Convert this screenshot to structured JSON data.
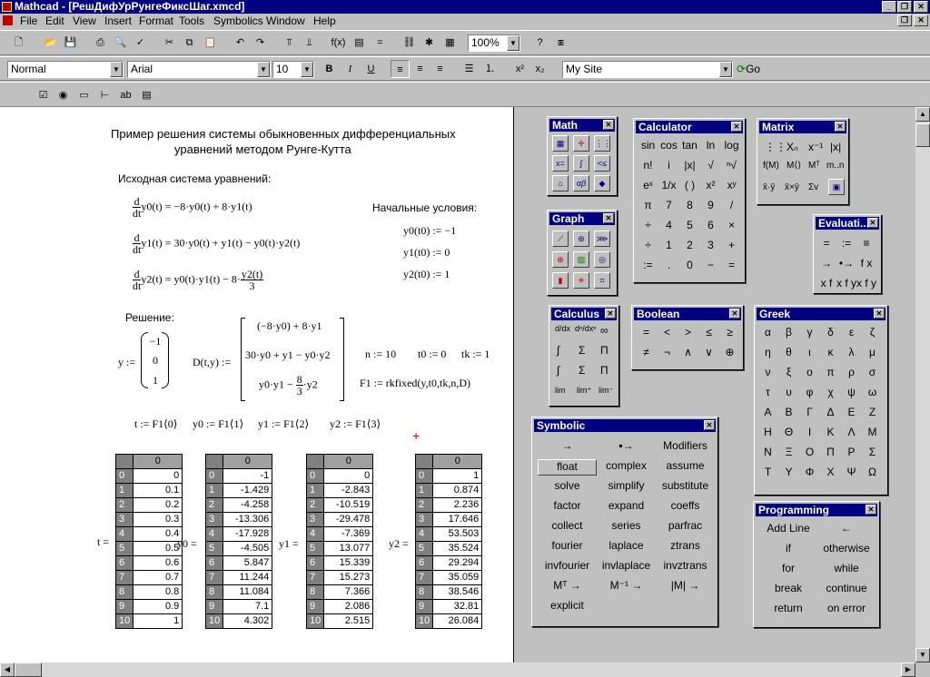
{
  "window": {
    "title": "Mathcad - [РешДифУрРунгеФиксШаг.xmcd]"
  },
  "menu": [
    "File",
    "Edit",
    "View",
    "Insert",
    "Format",
    "Tools",
    "Symbolics",
    "Window",
    "Help"
  ],
  "toolbar": {
    "zoom": "100%"
  },
  "format_bar": {
    "style": "Normal",
    "font": "Arial",
    "size": "10",
    "bold": "B",
    "italic": "I",
    "underline": "U",
    "address": "My Site",
    "go": "Go"
  },
  "doc": {
    "title_line1": "Пример решения системы обыкновенных дифференциальных",
    "title_line2": "уравнений методом Рунге-Кутта",
    "source_label": "Исходная система уравнений:",
    "initial_label": "Начальные условия:",
    "solution_label": "Решение:",
    "d": "d",
    "dt": "dt",
    "eq1_lhs": "y0(t)",
    "eq1_rhs": "= −8·y0(t) + 8·y1(t)",
    "eq2_lhs": "y1(t)",
    "eq2_rhs": "= 30·y0(t) + y1(t) − y0(t)·y2(t)",
    "eq3_lhs": "y2(t)",
    "eq3_mid": "= y0(t)·y1(t) − 8·",
    "eq3_num": "y2(t)",
    "eq3_den": "3",
    "ic1": "y0(t0) := −1",
    "ic2": "y1(t0) := 0",
    "ic3": "y2(t0) := 1",
    "y_def": "y :=",
    "y_vec": [
      "−1",
      "0",
      "1"
    ],
    "D_def": "D(t,y) :=",
    "D_row1": "(−8·y0) + 8·y1",
    "D_row2": "30·y0 + y1 − y0·y2",
    "D_row3a": "y0·y1 −",
    "D_row3_num": "8",
    "D_row3_den": "3",
    "D_row3b": "·y2",
    "n_def": "n := 10",
    "t0_def": "t0 := 0",
    "tk_def": "tk := 1",
    "F1_def": "F1 := rkfixed(y,t0,tk,n,D)",
    "t_col": "t := F1⟨0⟩",
    "y0_col": "y0 := F1⟨1⟩",
    "y1_col": "y1 := F1⟨2⟩",
    "y2_col": "y2 := F1⟨3⟩",
    "cursor": "+"
  },
  "tables": [
    {
      "label": "t =",
      "header": "0",
      "idx": [
        "0",
        "1",
        "2",
        "3",
        "4",
        "5",
        "6",
        "7",
        "8",
        "9",
        "10"
      ],
      "vals": [
        "0",
        "0.1",
        "0.2",
        "0.3",
        "0.4",
        "0.5",
        "0.6",
        "0.7",
        "0.8",
        "0.9",
        "1"
      ]
    },
    {
      "label": "y0 =",
      "header": "0",
      "idx": [
        "0",
        "1",
        "2",
        "3",
        "4",
        "5",
        "6",
        "7",
        "8",
        "9",
        "10"
      ],
      "vals": [
        "-1",
        "-1.429",
        "-4.258",
        "-13.306",
        "-17.928",
        "-4.505",
        "5.847",
        "11.244",
        "11.084",
        "7.1",
        "4.302"
      ]
    },
    {
      "label": "y1 =",
      "header": "0",
      "idx": [
        "0",
        "1",
        "2",
        "3",
        "4",
        "5",
        "6",
        "7",
        "8",
        "9",
        "10"
      ],
      "vals": [
        "0",
        "-2.843",
        "-10.519",
        "-29.478",
        "-7.369",
        "13.077",
        "15.339",
        "15.273",
        "7.366",
        "2.086",
        "2.515"
      ]
    },
    {
      "label": "y2 =",
      "header": "0",
      "idx": [
        "0",
        "1",
        "2",
        "3",
        "4",
        "5",
        "6",
        "7",
        "8",
        "9",
        "10"
      ],
      "vals": [
        "1",
        "0.874",
        "2.236",
        "17.646",
        "53.503",
        "35.524",
        "29.294",
        "35.059",
        "38.546",
        "32.81",
        "26.084"
      ]
    }
  ],
  "palettes": {
    "math": {
      "title": "Math"
    },
    "graph": {
      "title": "Graph"
    },
    "calculus": {
      "title": "Calculus"
    },
    "calculator": {
      "title": "Calculator",
      "keys": [
        "sin",
        "cos",
        "tan",
        "ln",
        "log",
        "n!",
        "i",
        "|x|",
        "√",
        "ⁿ√",
        "eˣ",
        "1/x",
        "( )",
        "x²",
        "xʸ",
        "π",
        "7",
        "8",
        "9",
        "/",
        "÷",
        "4",
        "5",
        "6",
        "×",
        "÷",
        "1",
        "2",
        "3",
        "+",
        ":=",
        ".",
        "0",
        "−",
        "="
      ]
    },
    "matrix": {
      "title": "Matrix"
    },
    "evaluation": {
      "title": "Evaluati...",
      "keys": [
        "=",
        ":=",
        "≡",
        "→",
        "•→",
        "f x",
        "x f",
        "x f y",
        "x f y"
      ]
    },
    "boolean": {
      "title": "Boolean",
      "keys": [
        "=",
        "<",
        ">",
        "≤",
        "≥",
        "≠",
        "¬",
        "∧",
        "∨",
        "⊕"
      ]
    },
    "greek": {
      "title": "Greek",
      "keys": [
        "α",
        "β",
        "γ",
        "δ",
        "ε",
        "ζ",
        "η",
        "θ",
        "ι",
        "κ",
        "λ",
        "μ",
        "ν",
        "ξ",
        "ο",
        "π",
        "ρ",
        "σ",
        "τ",
        "υ",
        "φ",
        "χ",
        "ψ",
        "ω",
        "Α",
        "Β",
        "Γ",
        "Δ",
        "Ε",
        "Ζ",
        "Η",
        "Θ",
        "Ι",
        "Κ",
        "Λ",
        "Μ",
        "Ν",
        "Ξ",
        "Ο",
        "Π",
        "Ρ",
        "Σ",
        "Τ",
        "Υ",
        "Φ",
        "Χ",
        "Ψ",
        "Ω"
      ]
    },
    "symbolic": {
      "title": "Symbolic",
      "keys": [
        "→",
        "▪→",
        "Modifiers",
        "float",
        "complex",
        "assume",
        "solve",
        "simplify",
        "substitute",
        "factor",
        "expand",
        "coeffs",
        "collect",
        "series",
        "parfrac",
        "fourier",
        "laplace",
        "ztrans",
        "invfourier",
        "invlaplace",
        "invztrans",
        "Mᵀ →",
        "M⁻¹ →",
        "|M| →",
        "explicit"
      ]
    },
    "programming": {
      "title": "Programming",
      "keys": [
        "Add Line",
        "←",
        "if",
        "otherwise",
        "for",
        "while",
        "break",
        "continue",
        "return",
        "on error"
      ]
    }
  }
}
